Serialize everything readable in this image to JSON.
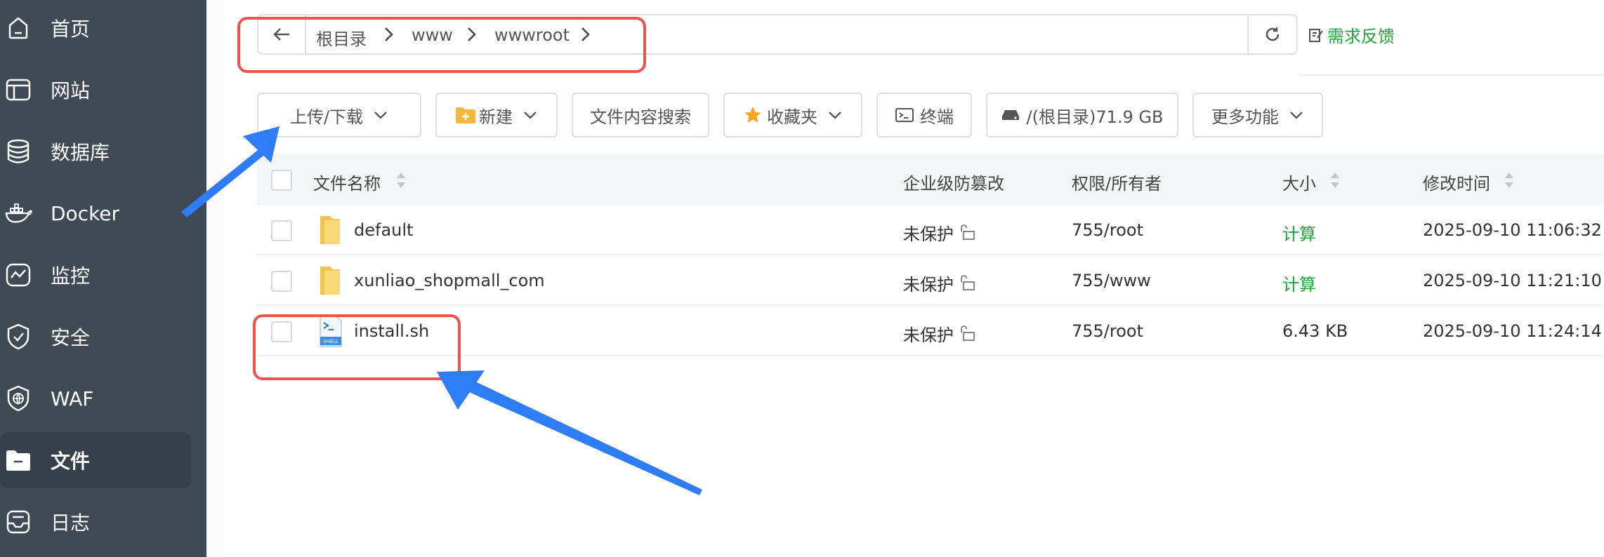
{
  "sidebar": {
    "items": [
      {
        "label": "首页",
        "icon": "home-icon"
      },
      {
        "label": "网站",
        "icon": "website-icon"
      },
      {
        "label": "数据库",
        "icon": "database-icon"
      },
      {
        "label": "Docker",
        "icon": "docker-icon"
      },
      {
        "label": "监控",
        "icon": "monitor-icon"
      },
      {
        "label": "安全",
        "icon": "shield-icon"
      },
      {
        "label": "WAF",
        "icon": "waf-icon"
      },
      {
        "label": "文件",
        "icon": "folder-icon",
        "active": true
      },
      {
        "label": "日志",
        "icon": "log-icon"
      }
    ]
  },
  "pathbar": {
    "crumbs": [
      "根目录",
      "www",
      "wwwroot"
    ],
    "feedback": "需求反馈"
  },
  "toolbar": {
    "upload": "上传/下载",
    "new": "新建",
    "search": "文件内容搜索",
    "favorites": "收藏夹",
    "terminal": "终端",
    "disk": "/(根目录)71.9 GB",
    "more": "更多功能"
  },
  "table": {
    "headers": {
      "name": "文件名称",
      "protect": "企业级防篡改",
      "perm": "权限/所有者",
      "size": "大小",
      "mtime": "修改时间"
    },
    "rows": [
      {
        "name": "default",
        "type": "folder",
        "protect": "未保护",
        "perm": "755/root",
        "size": "计算",
        "mtime": "2025-09-10 11:06:32"
      },
      {
        "name": "xunliao_shopmall_com",
        "type": "folder",
        "protect": "未保护",
        "perm": "755/www",
        "size": "计算",
        "mtime": "2025-09-10 11:21:10"
      },
      {
        "name": "install.sh",
        "type": "shell",
        "protect": "未保护",
        "perm": "755/root",
        "size": "6.43 KB",
        "mtime": "2025-09-10 11:24:14"
      }
    ]
  },
  "colors": {
    "sidebar_bg": "#3f4a55",
    "accent_green": "#20a53a",
    "annotation_red": "#ef5350",
    "annotation_arrow": "#2e7cf6"
  }
}
